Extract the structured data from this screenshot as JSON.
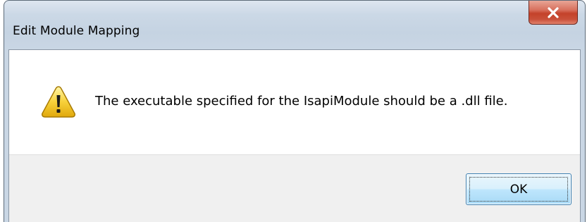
{
  "window": {
    "title": "Edit Module Mapping",
    "close_icon": "close-icon"
  },
  "message": {
    "icon": "warning-icon",
    "text": "The executable specified for the IsapiModule should be a .dll file."
  },
  "buttons": {
    "ok_label": "OK"
  },
  "colors": {
    "close_button": "#c4422a",
    "ok_button_border": "#3c7fb1",
    "button_panel": "#f0f0f0"
  }
}
